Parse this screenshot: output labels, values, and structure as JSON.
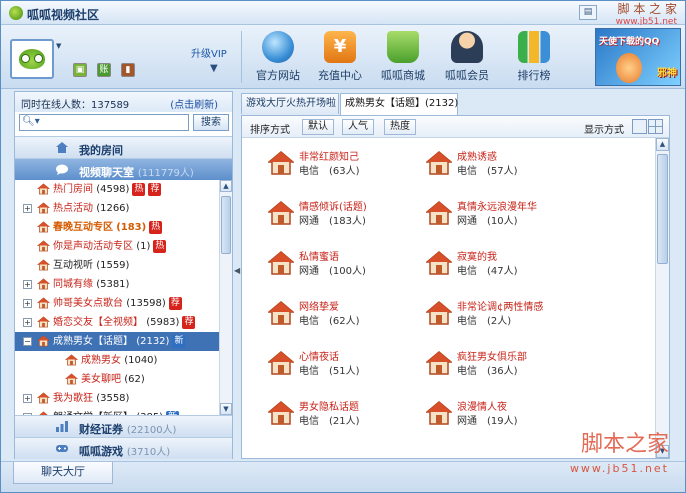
{
  "app": {
    "title": "呱呱视频社区"
  },
  "watermark": {
    "cn": "脚 本 之 家",
    "url": "www.jb51.net",
    "cn_bottom": "脚本之家",
    "url_bottom": "www.jb51.net"
  },
  "toolbar": {
    "upgrade_label": "升级VIP",
    "buttons": [
      {
        "label": "官方网站",
        "icon": "globe-icon",
        "color": "#3a8fd6"
      },
      {
        "label": "充值中心",
        "icon": "yuan-icon",
        "color": "#f08a1c"
      },
      {
        "label": "呱呱商城",
        "icon": "basket-icon",
        "color": "#4aa02c"
      },
      {
        "label": "呱呱会员",
        "icon": "member-icon",
        "color": "#2c3e57"
      },
      {
        "label": "排行榜",
        "icon": "ranking-icon",
        "color": "#3bb04a"
      }
    ],
    "banner_text": "天使下载的QQ",
    "banner_text2": "邪神"
  },
  "left": {
    "online_label": "同时在线人数：137589",
    "refresh_label": "(点击刷新)",
    "search_placeholder": "",
    "search_button": "搜索",
    "sections": {
      "my_room": "我的房间",
      "video_chat": "视频聊天室",
      "video_chat_count": "(111779人)",
      "finance": "财经证券",
      "finance_count": "(22100人)",
      "games": "呱呱游戏",
      "games_count": "(3710人)"
    },
    "tree": [
      {
        "label": "热门房间",
        "count": "(4598)",
        "expand": "",
        "indent": 0,
        "style": "red",
        "tags": [
          "热",
          "荐"
        ]
      },
      {
        "label": "热点活动",
        "count": "(1266)",
        "expand": "+",
        "indent": 0,
        "style": "red",
        "tags": []
      },
      {
        "label": "春晚互动专区",
        "count": "(183)",
        "expand": "",
        "indent": 0,
        "style": "orange",
        "tags": [
          "热"
        ]
      },
      {
        "label": "你是声动活动专区",
        "count": "(1)",
        "expand": "",
        "indent": 0,
        "style": "red",
        "tags": [
          "热"
        ]
      },
      {
        "label": "互动视听",
        "count": "(1559)",
        "expand": "",
        "indent": 0,
        "style": "",
        "tags": []
      },
      {
        "label": "同城有缘",
        "count": "(5381)",
        "expand": "+",
        "indent": 0,
        "style": "red",
        "tags": []
      },
      {
        "label": "帅哥美女点歌台",
        "count": "(13598)",
        "expand": "+",
        "indent": 0,
        "style": "red",
        "tags": [
          "荐"
        ]
      },
      {
        "label": "婚恋交友【全视频】",
        "count": "(5983)",
        "expand": "+",
        "indent": 0,
        "style": "red",
        "tags": [
          "荐"
        ]
      },
      {
        "label": "成熟男女【话题】",
        "count": "(2132)",
        "expand": "−",
        "indent": 0,
        "style": "sel",
        "tags": [
          "新"
        ]
      },
      {
        "label": "成熟男女",
        "count": "(1040)",
        "expand": "",
        "indent": 1,
        "style": "red",
        "tags": []
      },
      {
        "label": "美女聊吧",
        "count": "(62)",
        "expand": "",
        "indent": 1,
        "style": "red",
        "tags": []
      },
      {
        "label": "我为歌狂",
        "count": "(3558)",
        "expand": "+",
        "indent": 0,
        "style": "red",
        "tags": []
      },
      {
        "label": "朗诵文学【新区】",
        "count": "(385)",
        "expand": "+",
        "indent": 0,
        "style": "",
        "tags": [
          "新"
        ]
      }
    ]
  },
  "right": {
    "tabs": [
      "游戏大厅火热开场啦",
      "成熟男女【话题】(2132)"
    ],
    "sort_label": "排序方式",
    "sort_buttons": [
      "默认",
      "人气",
      "热度"
    ],
    "display_label": "显示方式",
    "rooms": [
      {
        "name": "非常红颜知己",
        "status": "电信　(63人)"
      },
      {
        "name": "成熟诱惑",
        "status": "电信　(57人)"
      },
      {
        "name": "情感倾诉(话题)",
        "status": "网通　(183人)"
      },
      {
        "name": "真情永远浪漫年华",
        "status": "网通　(10人)"
      },
      {
        "name": "私情蜜语",
        "status": "网通　(100人)"
      },
      {
        "name": "寂寞的我",
        "status": "电信　(47人)"
      },
      {
        "name": "网络挚爱",
        "status": "电信　(62人)"
      },
      {
        "name": "非常论调¢两性情感",
        "status": "电信　(2人)"
      },
      {
        "name": "心情夜话",
        "status": "电信　(51人)"
      },
      {
        "name": "疯狂男女俱乐部",
        "status": "电信　(36人)"
      },
      {
        "name": "男女隐私话题",
        "status": "电信　(21人)"
      },
      {
        "name": "浪漫情人夜",
        "status": "网通　(19人)"
      }
    ]
  },
  "bottom": {
    "tab": "聊天大厅"
  }
}
